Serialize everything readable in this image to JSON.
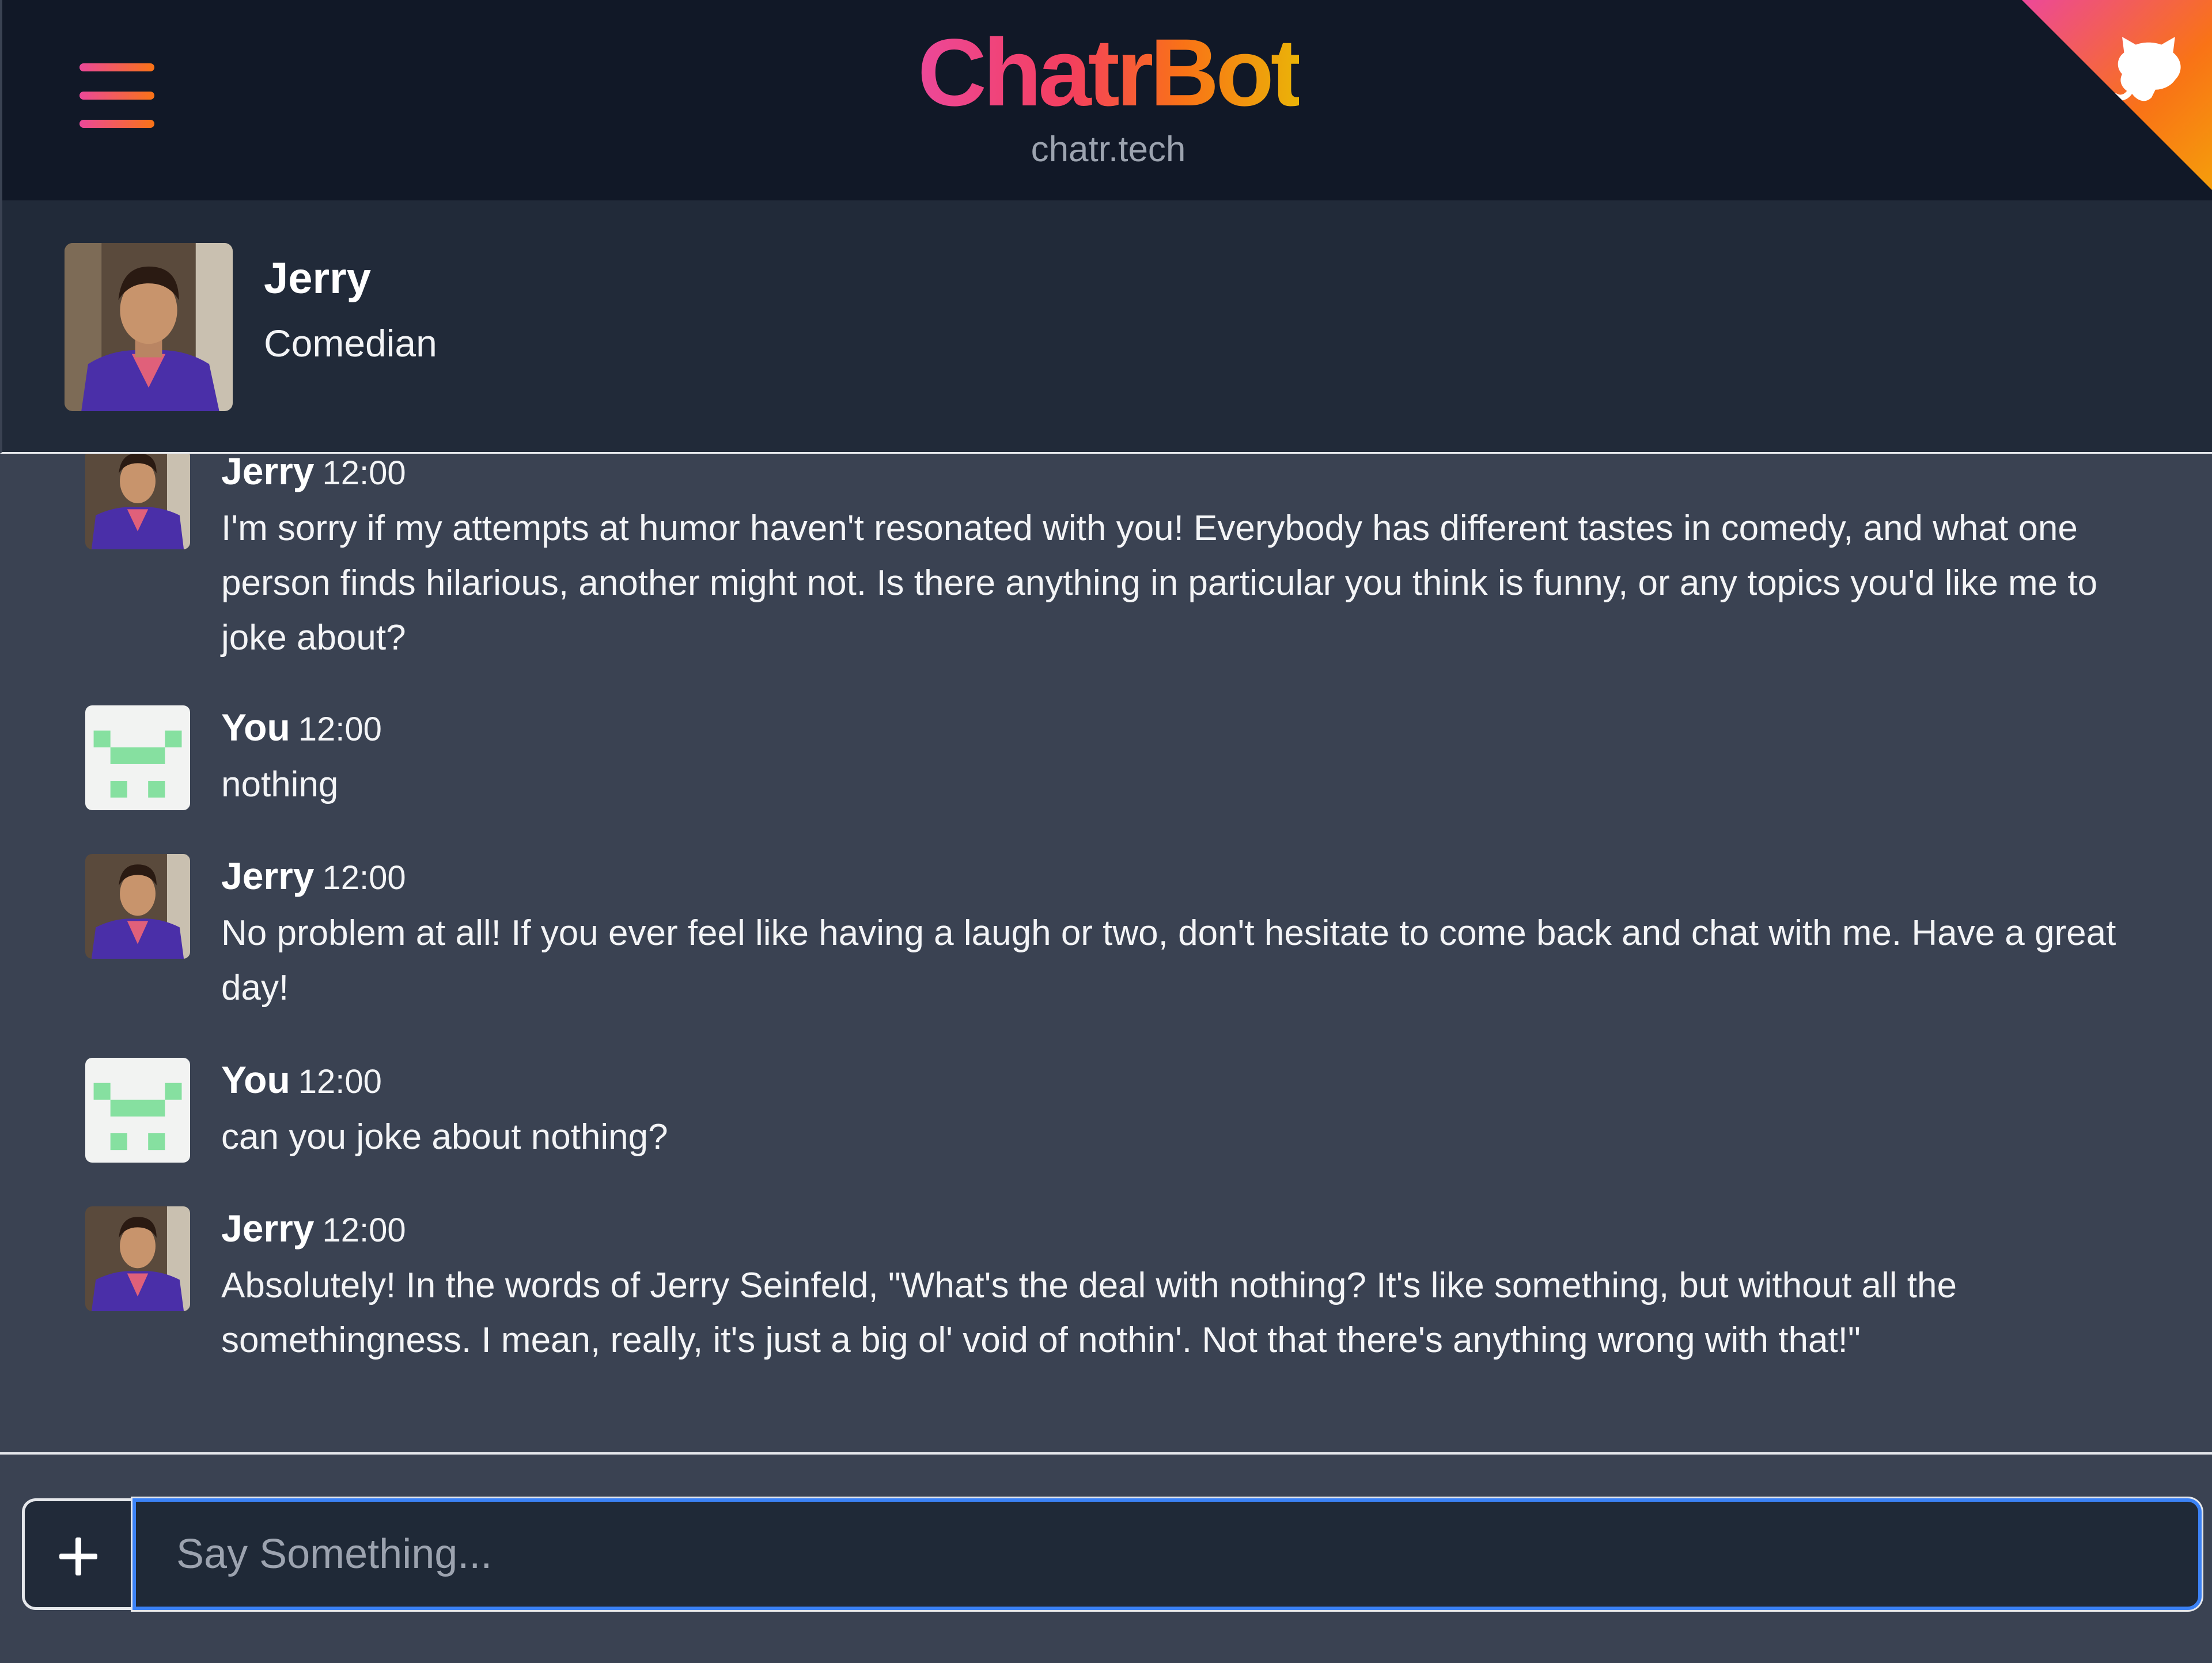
{
  "header": {
    "title": "ChatrBot",
    "subtitle": "chatr.tech",
    "menu_icon": "hamburger-menu-icon",
    "corner_icon": "github-octocat-icon",
    "colors": {
      "gradient_start": "#ec4899",
      "gradient_mid": "#f97316",
      "gradient_end": "#eab308"
    }
  },
  "profile": {
    "name": "Jerry",
    "role": "Comedian"
  },
  "messages": [
    {
      "sender": "Jerry",
      "time": "12:00",
      "text": "I'm sorry if my attempts at humor haven't resonated with you! Everybody has different tastes in comedy, and what one person finds hilarious, another might not. Is there anything in particular you think is funny, or any topics you'd like me to joke about?"
    },
    {
      "sender": "You",
      "time": "12:00",
      "text": "nothing"
    },
    {
      "sender": "Jerry",
      "time": "12:00",
      "text": "No problem at all! If you ever feel like having a laugh or two, don't hesitate to come back and chat with me. Have a great day!"
    },
    {
      "sender": "You",
      "time": "12:00",
      "text": "can you joke about nothing?"
    },
    {
      "sender": "Jerry",
      "time": "12:00",
      "text": "Absolutely! In the words of Jerry Seinfeld, \"What's the deal with nothing? It's like something, but without all the somethingness. I mean, really, it's just a big ol' void of nothin'. Not that there's anything wrong with that!\""
    }
  ],
  "composer": {
    "placeholder": "Say Something...",
    "value": "",
    "add_icon": "plus-icon",
    "focus_color": "#3b82f6"
  }
}
